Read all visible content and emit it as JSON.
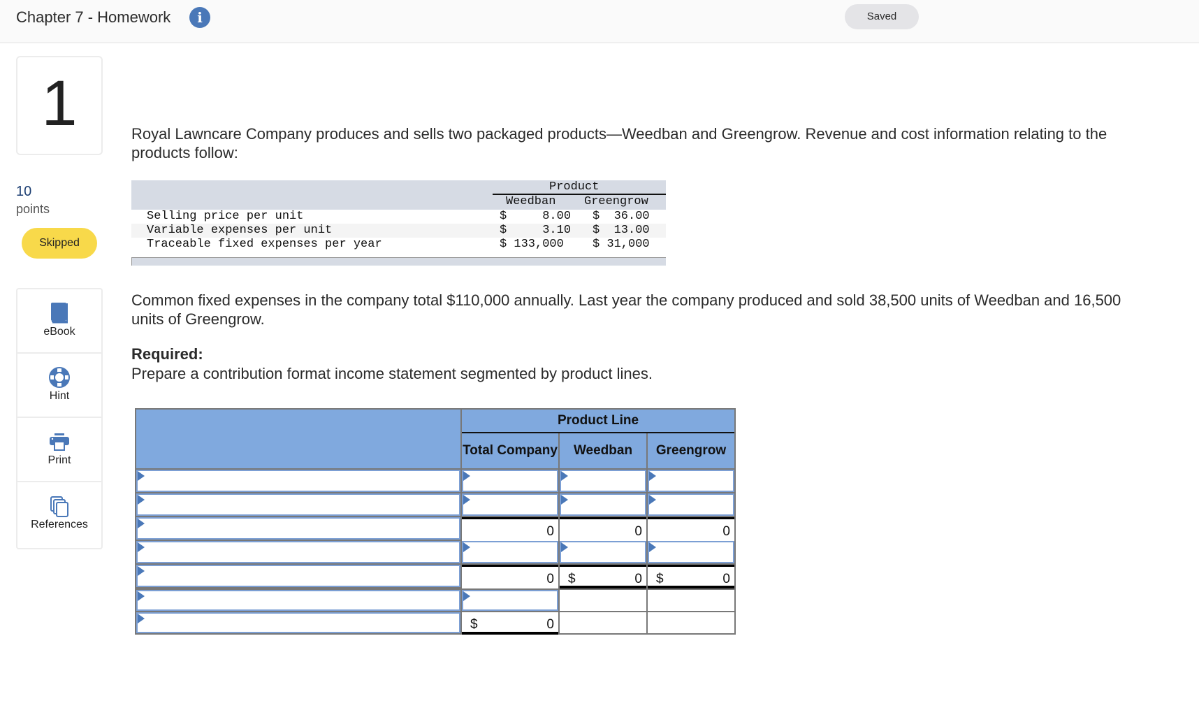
{
  "header": {
    "title": "Chapter 7 - Homework",
    "info_icon": "info-circle-icon",
    "saved_label": "Saved"
  },
  "question": {
    "number": "1",
    "points_value": "10",
    "points_label": "points",
    "status": "Skipped"
  },
  "tools": [
    {
      "label": "eBook",
      "icon": "book-icon"
    },
    {
      "label": "Hint",
      "icon": "lifebuoy-icon"
    },
    {
      "label": "Print",
      "icon": "printer-icon"
    },
    {
      "label": "References",
      "icon": "documents-icon"
    }
  ],
  "content": {
    "intro": "Royal Lawncare Company produces and sells two packaged products—Weedban and Greengrow. Revenue and cost information relating to the products follow:",
    "common_fixed": "Common fixed expenses in the company total $110,000 annually. Last year the company produced and sold 38,500 units of Weedban and 16,500 units of Greengrow.",
    "required_heading": "Required:",
    "required_text": "Prepare a contribution format income statement segmented by product lines."
  },
  "reference_table": {
    "group_header": "Product",
    "columns": [
      "Weedban",
      "Greengrow"
    ],
    "rows": [
      {
        "label": "Selling price per unit",
        "weedban": "$     8.00",
        "greengrow": "$  36.00"
      },
      {
        "label": "Variable expenses per unit",
        "weedban": "$     3.10",
        "greengrow": "$  13.00"
      },
      {
        "label": "Traceable fixed expenses per year",
        "weedban": "$ 133,000",
        "greengrow": "$ 31,000"
      }
    ]
  },
  "answer_table": {
    "group_header": "Product Line",
    "col_total": "Total Company",
    "col_weedban": "Weedban",
    "col_greengrow": "Greengrow",
    "rows": [
      {
        "label": "",
        "total": "",
        "weedban": "",
        "greengrow": ""
      },
      {
        "label": "",
        "total": "",
        "weedban": "",
        "greengrow": ""
      },
      {
        "label": "",
        "total": "0",
        "weedban": "0",
        "greengrow": "0"
      },
      {
        "label": "",
        "total": "",
        "weedban": "",
        "greengrow": ""
      },
      {
        "label": "",
        "total": "0",
        "weedban_prefix": "$",
        "weedban": "0",
        "greengrow_prefix": "$",
        "greengrow": "0"
      },
      {
        "label": "",
        "total": ""
      },
      {
        "label": "",
        "total_prefix": "$",
        "total": "0"
      }
    ]
  },
  "colors": {
    "accent_blue": "#4a78b8",
    "header_blue": "#80a9de",
    "skipped_yellow": "#f8d94a",
    "points_blue": "#1d3f73"
  }
}
